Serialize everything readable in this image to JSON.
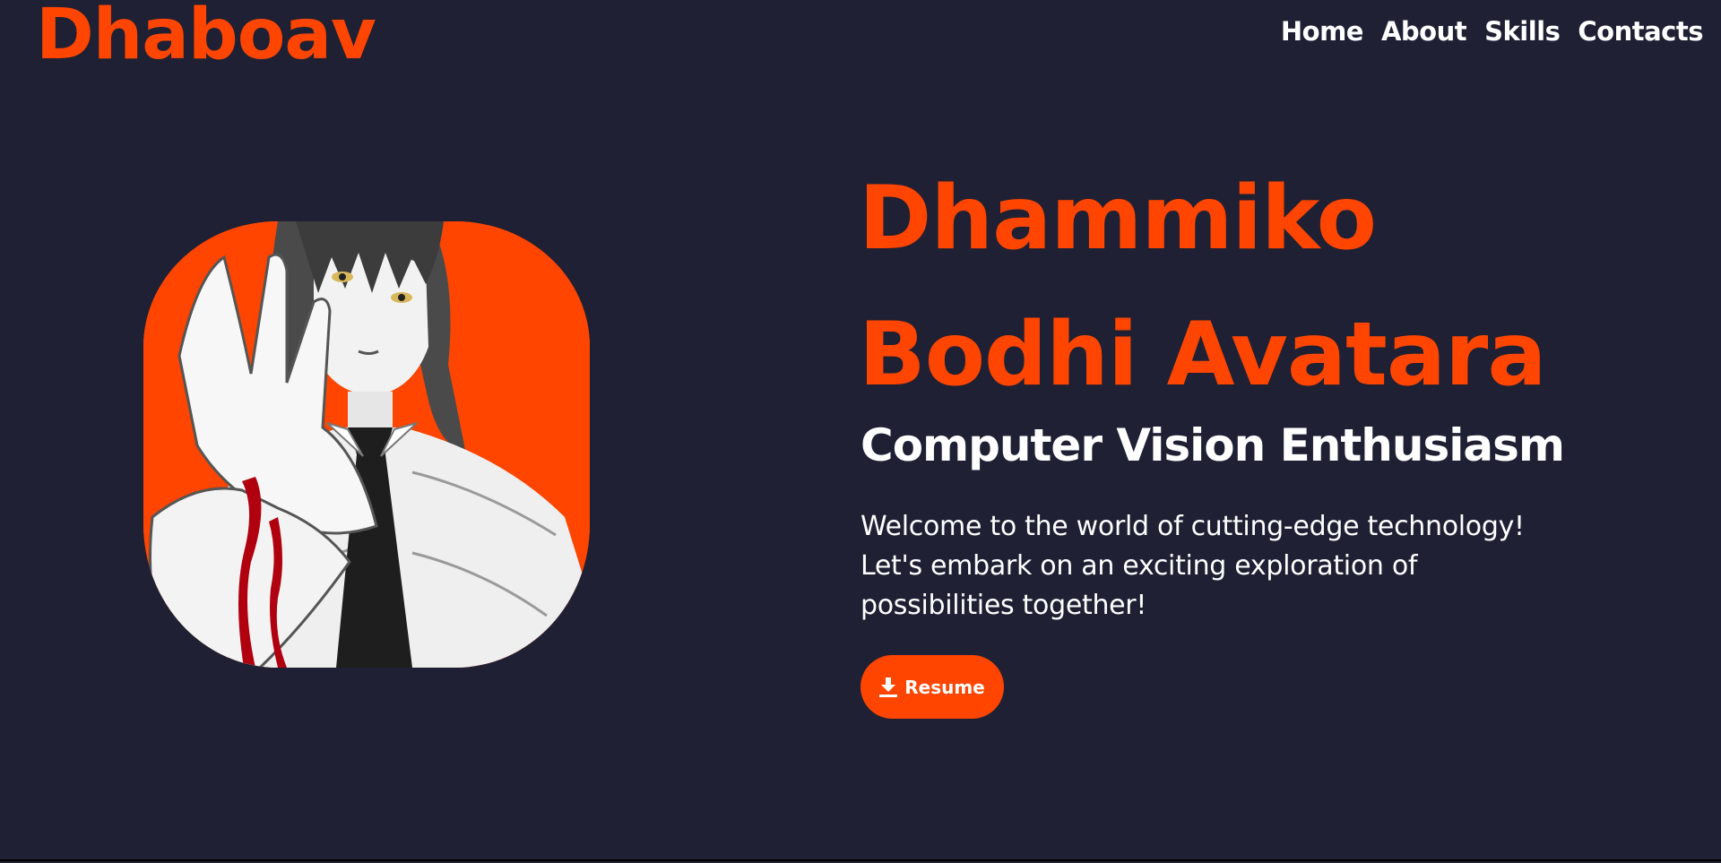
{
  "brand": {
    "logo_text": "Dhaboav",
    "accent_color": "#ff4500",
    "background_color": "#1f2033"
  },
  "nav": {
    "items": [
      {
        "label": "Home"
      },
      {
        "label": "About"
      },
      {
        "label": "Skills"
      },
      {
        "label": "Contacts"
      }
    ]
  },
  "hero": {
    "name_line1": "Dhammiko",
    "name_line2": "Bodhi Avatara",
    "subtitle": "Computer Vision Enthusiasm",
    "welcome_line1": "Welcome to the world of cutting-edge technology!",
    "welcome_line2": "Let's embark on an exciting exploration of",
    "welcome_line3": "possibilities together!",
    "resume_label": "Resume",
    "resume_icon": "download-icon",
    "profile_image": "anime-character-portrait"
  }
}
